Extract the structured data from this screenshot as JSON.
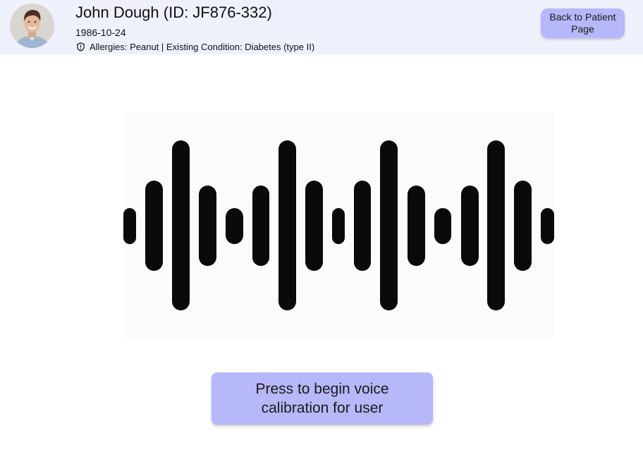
{
  "patient": {
    "name_line": "John Dough (ID: JF876-332)",
    "dob": "1986-10-24",
    "alerts": "Allergies: Peanut | Existing Condition: Diabetes (type II)",
    "alert_icon": "shield-icon",
    "avatar_icon": "avatar"
  },
  "nav": {
    "back_label": "Back to Patient Page"
  },
  "main": {
    "waveform_icon": "sound-wave-icon",
    "calibrate_label": "Press to begin voice calibration for user"
  },
  "colors": {
    "header_bg": "#eef0fc",
    "button_bg": "#b6b8fa",
    "wave_bar": "#0a0a0a"
  }
}
